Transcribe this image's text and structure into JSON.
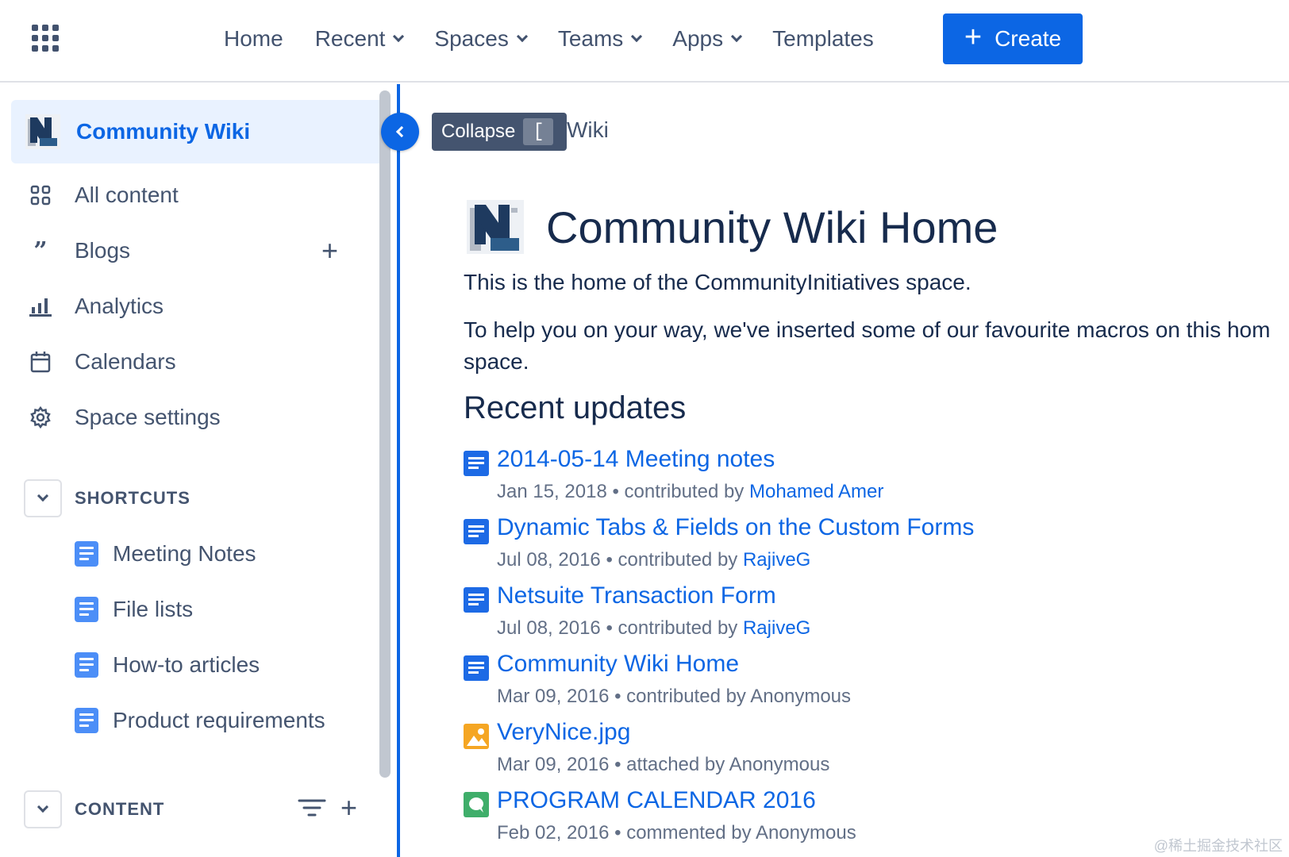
{
  "nav": {
    "home": "Home",
    "recent": "Recent",
    "spaces": "Spaces",
    "teams": "Teams",
    "apps": "Apps",
    "templates": "Templates",
    "create": "Create"
  },
  "sidebar": {
    "space_name": "Community Wiki",
    "items": [
      {
        "label": "All content",
        "icon": "grid-icon"
      },
      {
        "label": "Blogs",
        "icon": "quote-icon"
      },
      {
        "label": "Analytics",
        "icon": "bar-chart-icon"
      },
      {
        "label": "Calendars",
        "icon": "calendar-icon"
      },
      {
        "label": "Space settings",
        "icon": "gear-icon"
      }
    ],
    "shortcuts_title": "SHORTCUTS",
    "shortcuts": [
      {
        "label": "Meeting Notes"
      },
      {
        "label": "File lists"
      },
      {
        "label": "How-to articles"
      },
      {
        "label": "Product requirements"
      }
    ],
    "content_title": "CONTENT"
  },
  "tooltip": {
    "label": "Collapse",
    "shortcut_key": "["
  },
  "main": {
    "breadcrumb_tail": "Wiki",
    "title": "Community Wiki Home",
    "intro": "This is the home of the CommunityInitiatives space.",
    "help_line1": "To help you on your way, we've inserted some of our favourite macros on this hom",
    "help_line2": "space.",
    "recent_title": "Recent updates",
    "updates": [
      {
        "title": "2014-05-14 Meeting notes",
        "date": "Jan 15, 2018",
        "action": "contributed by",
        "who": "Mohamed Amer",
        "type": "page"
      },
      {
        "title": "Dynamic Tabs & Fields on the Custom Forms",
        "date": "Jul 08, 2016",
        "action": "contributed by",
        "who": "RajiveG",
        "type": "page"
      },
      {
        "title": "Netsuite Transaction Form",
        "date": "Jul 08, 2016",
        "action": "contributed by",
        "who": "RajiveG",
        "type": "page"
      },
      {
        "title": "Community Wiki Home",
        "date": "Mar 09, 2016",
        "action": "contributed by",
        "who": "Anonymous",
        "type": "page"
      },
      {
        "title": "VeryNice.jpg",
        "date": "Mar 09, 2016",
        "action": "attached by",
        "who": "Anonymous",
        "type": "image"
      },
      {
        "title": "PROGRAM CALENDAR 2016",
        "date": "Feb 02, 2016",
        "action": "commented by",
        "who": "Anonymous",
        "type": "comment"
      }
    ],
    "bullet": "•"
  },
  "watermark": "@稀土掘金技术社区",
  "colors": {
    "accent": "#0c66e4",
    "text": "#172b4d",
    "subtle": "#44546f",
    "selected_bg": "#e9f2ff"
  }
}
